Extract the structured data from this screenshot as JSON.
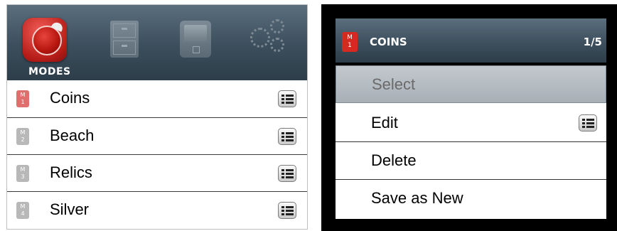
{
  "left": {
    "modes_label": "MODES",
    "tabs": [
      {
        "icon": "coins-icon",
        "active": true
      },
      {
        "icon": "cabinet-icon",
        "active": false
      },
      {
        "icon": "device-icon",
        "active": false
      },
      {
        "icon": "gears-icon",
        "active": false
      }
    ],
    "items": [
      {
        "badge_m": "M",
        "badge_n": "1",
        "label": "Coins",
        "badge_color": "#e06e6c"
      },
      {
        "badge_m": "M",
        "badge_n": "2",
        "label": "Beach",
        "badge_color": "#b8b8b8"
      },
      {
        "badge_m": "M",
        "badge_n": "3",
        "label": "Relics",
        "badge_color": "#b8b8b8"
      },
      {
        "badge_m": "M",
        "badge_n": "4",
        "label": "Silver",
        "badge_color": "#b8b8b8"
      }
    ]
  },
  "right": {
    "badge_m": "M",
    "badge_n": "1",
    "title": "COINS",
    "count": "1/5",
    "options": [
      {
        "label": "Select",
        "selected": true
      },
      {
        "label": "Edit",
        "selected": false
      },
      {
        "label": "Delete",
        "selected": false
      },
      {
        "label": "Save as New",
        "selected": false
      }
    ]
  },
  "colors": {
    "header_bg": "#3c4e5c",
    "selected_bg": "#b4bbc2",
    "active_badge": "#d42a22"
  }
}
